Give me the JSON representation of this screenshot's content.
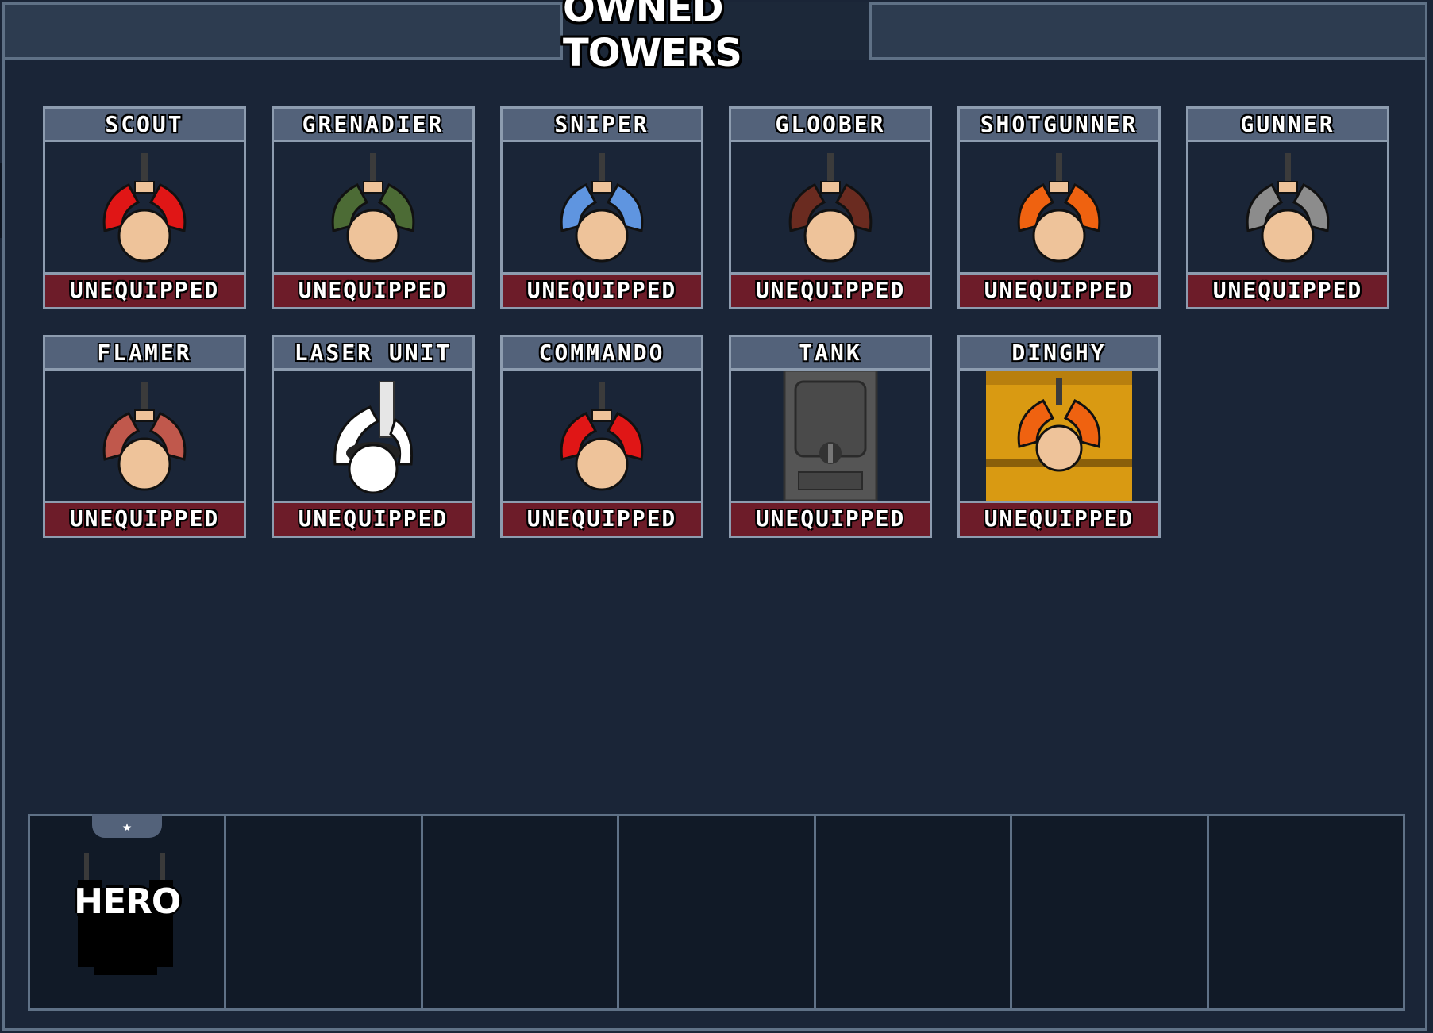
{
  "header": {
    "title": "OWNED TOWERS"
  },
  "towers": [
    {
      "name": "SCOUT",
      "status": "UNEQUIPPED",
      "color": "#e01616",
      "art": "soldier"
    },
    {
      "name": "GRENADIER",
      "status": "UNEQUIPPED",
      "color": "#4c6b35",
      "art": "soldier"
    },
    {
      "name": "SNIPER",
      "status": "UNEQUIPPED",
      "color": "#5f95e0",
      "art": "soldier"
    },
    {
      "name": "GLOOBER",
      "status": "UNEQUIPPED",
      "color": "#6a2b20",
      "art": "soldier"
    },
    {
      "name": "SHOTGUNNER",
      "status": "UNEQUIPPED",
      "color": "#ef6210",
      "art": "soldier"
    },
    {
      "name": "GUNNER",
      "status": "UNEQUIPPED",
      "color": "#8c8c8c",
      "art": "soldier"
    },
    {
      "name": "FLAMER",
      "status": "UNEQUIPPED",
      "color": "#c0584c",
      "art": "soldier"
    },
    {
      "name": "LASER UNIT",
      "status": "UNEQUIPPED",
      "color": "#ffffff",
      "art": "laser"
    },
    {
      "name": "COMMANDO",
      "status": "UNEQUIPPED",
      "color": "#e01616",
      "art": "soldier"
    },
    {
      "name": "TANK",
      "status": "UNEQUIPPED",
      "color": "#4a4a4a",
      "art": "tank"
    },
    {
      "name": "DINGHY",
      "status": "UNEQUIPPED",
      "color": "#d99a12",
      "art": "dinghy"
    }
  ],
  "loadout": {
    "slots": [
      {
        "label": "HERO",
        "tab_icon": "star-icon",
        "occupied": true
      },
      {
        "label": "",
        "occupied": false
      },
      {
        "label": "",
        "occupied": false
      },
      {
        "label": "",
        "occupied": false
      },
      {
        "label": "",
        "occupied": false
      },
      {
        "label": "",
        "occupied": false
      },
      {
        "label": "",
        "occupied": false
      }
    ]
  },
  "colors": {
    "background": "#1a2537",
    "card_header": "#53627a",
    "status_unequipped": "#6d1c29",
    "skin": "#eec39a"
  }
}
